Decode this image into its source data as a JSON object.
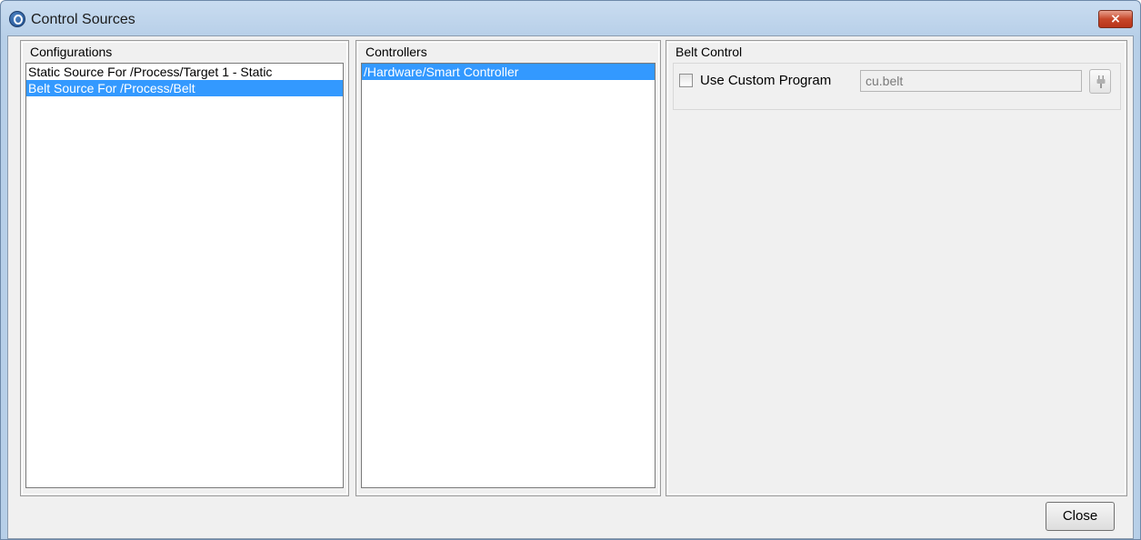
{
  "window": {
    "title": "Control Sources",
    "close_glyph": "×"
  },
  "configurations": {
    "title": "Configurations",
    "items": [
      {
        "label": "Static Source For /Process/Target 1 - Static",
        "selected": false
      },
      {
        "label": "Belt Source For /Process/Belt",
        "selected": true
      }
    ]
  },
  "controllers": {
    "title": "Controllers",
    "items": [
      {
        "label": "/Hardware/Smart Controller",
        "selected": true
      }
    ]
  },
  "belt_control": {
    "title": "Belt Control",
    "custom_program": {
      "label": "Use Custom Program",
      "checked": false,
      "value": "cu.belt",
      "enabled": false,
      "button_icon": "plug-icon"
    }
  },
  "footer": {
    "close_label": "Close"
  },
  "colors": {
    "selection": "#3399ff",
    "selection_text": "#ffffff",
    "window_frame": "#b7cfe8",
    "dialog_background": "#f0f0f0",
    "close_x": "#c7472a"
  }
}
